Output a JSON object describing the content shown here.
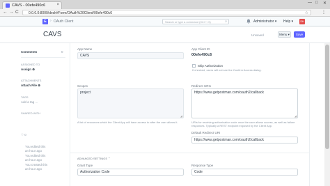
{
  "browser": {
    "tab_title": "CAVS - 00efe490c6",
    "tab_close": "×",
    "url": "0.0.0.0:8000/desk#Form/OAuth%20Client/00efe490c6",
    "back": "←",
    "forward": "→",
    "reload": "C",
    "star": "☆",
    "menu": "⋮",
    "minimize": "—",
    "maximize": "□",
    "close": "✕"
  },
  "navbar": {
    "logo": "E",
    "breadcrumb_chevron": "›",
    "breadcrumb": "OAuth Client",
    "search_placeholder": "Search or type a command (Ctrl + G)",
    "search_icon": "⌕",
    "bell_icon": "🔔",
    "user_menu": "Administrator ▾",
    "help_menu": "Help ▾",
    "avatar_initials": "SH"
  },
  "page": {
    "title": "CAVS",
    "modified": "Unsaved",
    "menu_button": "Menu ▾",
    "save_button": "Save"
  },
  "sidebar": {
    "comments_label": "Comments",
    "comments_count": "0",
    "assigned_to_label": "ASSIGNED TO",
    "assign_link": "Assign ⊕",
    "attachments_label": "ATTACHMENTS",
    "attach_link": "Attach File ⊕",
    "tags_label": "TAGS",
    "add_tag": "Add a tag ...",
    "shared_label": "SHARED WITH",
    "likes": "♡ 0",
    "edited_1": "You edited this",
    "edited_time_1": "an hour ago",
    "edited_2": "You edited this",
    "edited_time_2": "an hour ago",
    "created": "You created this",
    "created_time": "an hour ago"
  },
  "form": {
    "app_name_label": "App Name",
    "app_name_value": "CAVS",
    "app_client_id_label": "App Client ID",
    "app_client_id_value": "00efe490c6",
    "skip_auth_label": "Skip Authorization",
    "skip_auth_desc": "If checked, users will not see the Confirm Access dialog.",
    "scopes_label": "Scopes",
    "scopes_value": "project",
    "scopes_desc": "A list of resources which the Client App will have access to after the user allows it.",
    "redirect_uris_label": "Redirect URIs",
    "redirect_uris_value": "https://www.getpostman.com/oauth2/callback",
    "redirect_uris_desc": "URIs for receiving authorization code once the user allows access, as well as failure responses. Typically a REST endpoint exposed by the Client App.",
    "default_redirect_label": "Default Redirect URI",
    "default_redirect_value": "https://www.getpostman.com/oauth2/callback",
    "advanced_settings": "ADVANCED SETTINGS ⌃",
    "grant_type_label": "Grant Type",
    "grant_type_value": "Authorization Code",
    "response_type_label": "Response Type",
    "response_type_value": "Code"
  }
}
